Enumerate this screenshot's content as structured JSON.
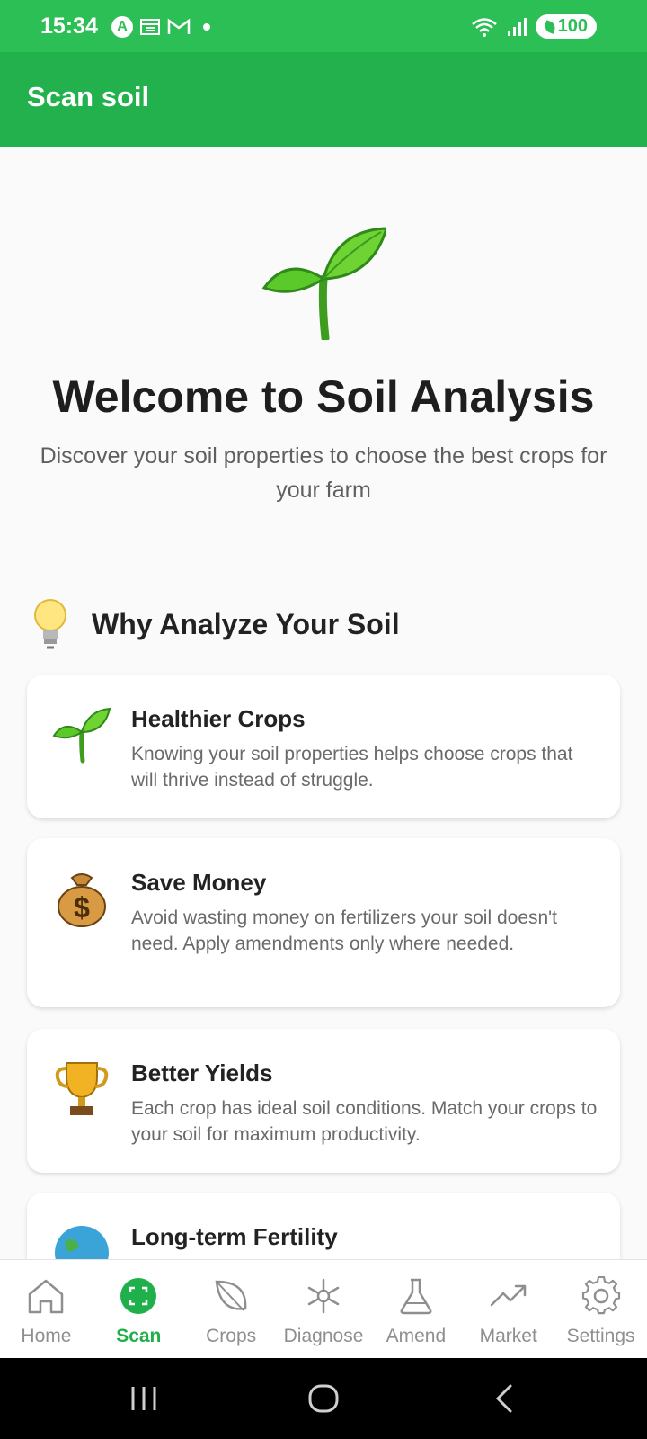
{
  "status_bar": {
    "time": "15:34",
    "battery": "100",
    "network_type": "5",
    "icons": [
      "a-icon",
      "calendar-icon",
      "gmail-icon",
      "dot-icon",
      "wifi-icon",
      "signal-icon",
      "battery-icon"
    ]
  },
  "app_bar": {
    "title": "Scan soil"
  },
  "hero": {
    "icon": "sprout-icon",
    "title": "Welcome to Soil Analysis",
    "subtitle": "Discover your soil properties to choose the best crops for your farm"
  },
  "section": {
    "icon": "lightbulb-icon",
    "title": "Why Analyze Your Soil"
  },
  "cards": [
    {
      "icon": "sprout-icon",
      "title": "Healthier Crops",
      "description": "Knowing your soil properties helps choose crops that will thrive instead of struggle."
    },
    {
      "icon": "money-bag-icon",
      "title": "Save Money",
      "description": "Avoid wasting money on fertilizers your soil doesn't need. Apply amendments only where needed."
    },
    {
      "icon": "trophy-icon",
      "title": "Better Yields",
      "description": "Each crop has ideal soil conditions. Match your crops to your soil for maximum productivity."
    },
    {
      "icon": "globe-icon",
      "title": "Long-term Fertility",
      "description": ""
    }
  ],
  "bottom_nav": {
    "active": "Scan",
    "items": [
      {
        "label": "Home",
        "icon": "home-icon"
      },
      {
        "label": "Scan",
        "icon": "scan-icon"
      },
      {
        "label": "Crops",
        "icon": "leaf-icon"
      },
      {
        "label": "Diagnose",
        "icon": "asterisk-icon"
      },
      {
        "label": "Amend",
        "icon": "flask-icon"
      },
      {
        "label": "Market",
        "icon": "trend-up-icon"
      },
      {
        "label": "Settings",
        "icon": "gear-icon"
      }
    ]
  },
  "colors": {
    "primary": "#22b14c",
    "status_bar": "#2bbf55",
    "active_nav": "#1fb04b",
    "inactive_nav": "#8f8f8f"
  }
}
